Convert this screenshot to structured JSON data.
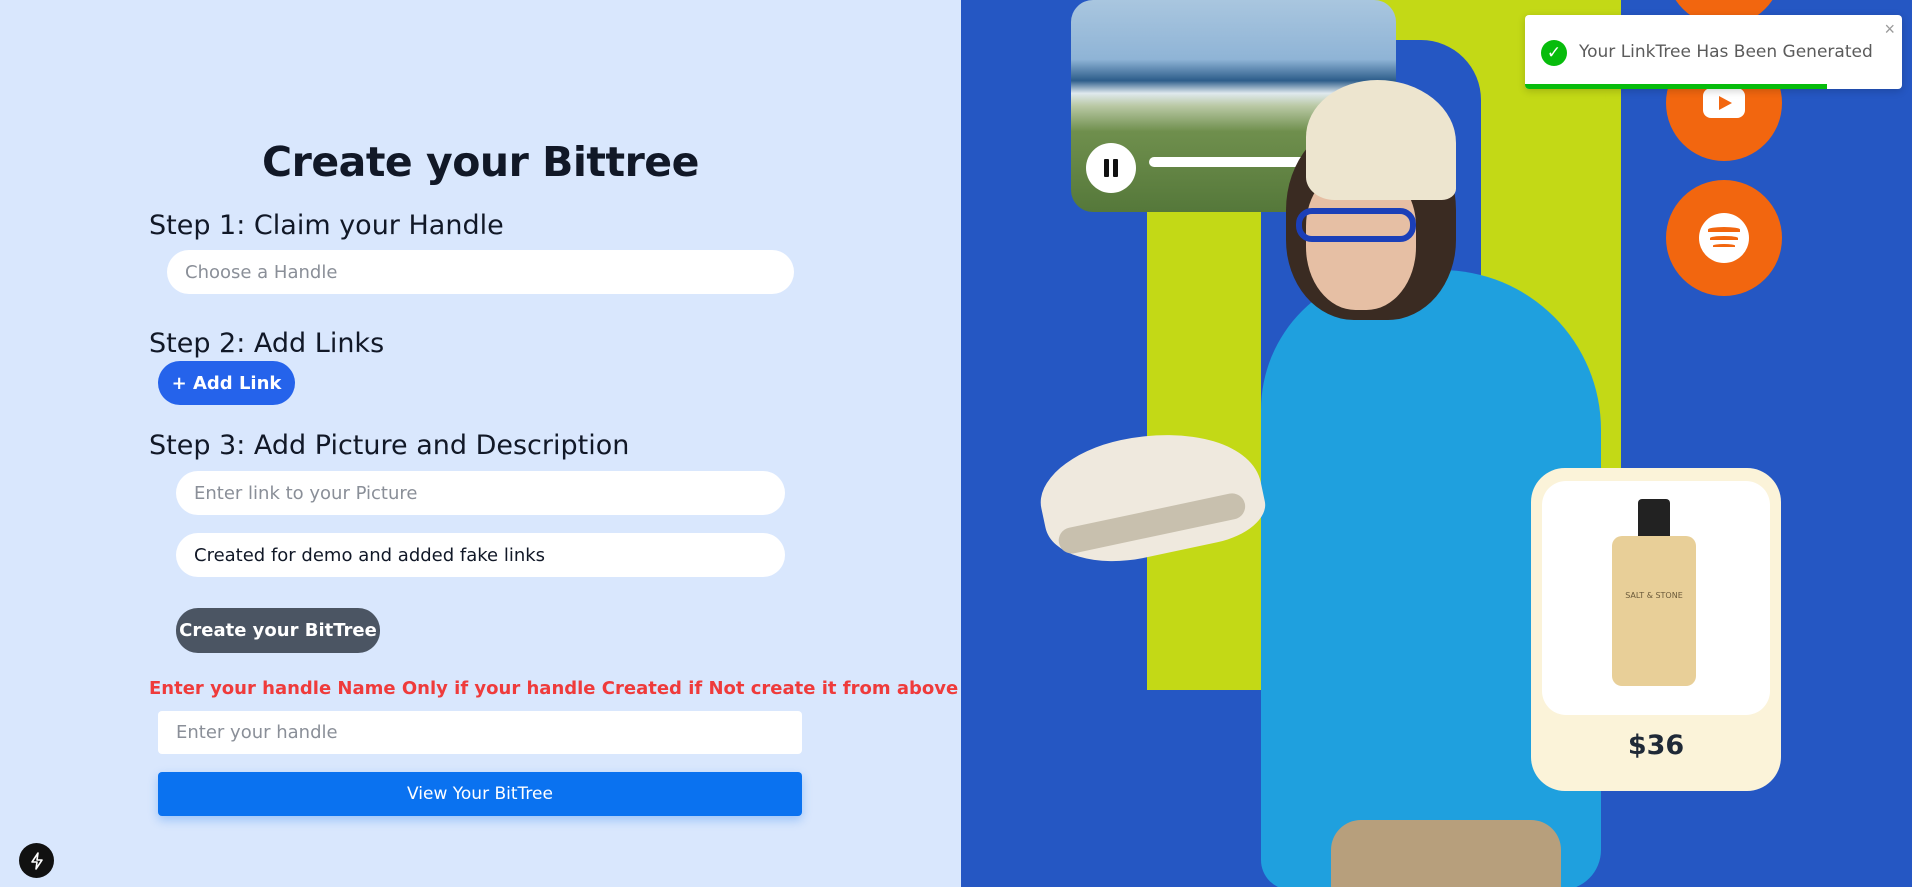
{
  "left_panel": {
    "title": "Create your Bittree",
    "step1": {
      "heading": "Step 1: Claim your Handle",
      "handle_placeholder": "Choose a Handle",
      "handle_value": ""
    },
    "step2": {
      "heading": "Step 2: Add Links",
      "add_link_label": "+ Add Link"
    },
    "step3": {
      "heading": "Step 3: Add Picture and Description",
      "picture_placeholder": "Enter link to your Picture",
      "picture_value": "",
      "description_value": "Created for demo and added fake links"
    },
    "create_label": "Create your BitTree",
    "warning": "Enter your handle Name Only if your handle Created if Not create it from above",
    "view_handle_placeholder": "Enter your handle",
    "view_label": "View Your BitTree"
  },
  "artwork": {
    "product_price": "$36",
    "bottle_label": "SALT & STONE",
    "icons": [
      "pause-icon",
      "youtube-icon",
      "spotify-icon"
    ]
  },
  "toast": {
    "message": "Your LinkTree Has Been Generated",
    "close_glyph": "×",
    "progress": 0.8,
    "accent": "#07bc0c"
  },
  "colors": {
    "primary": "#2563eb",
    "view_button": "#0a72f0",
    "warning": "#ef3b3b",
    "panel_bg": "#d9e7fd",
    "art_blue": "#2557c3",
    "art_green": "#c3d916",
    "art_orange": "#f2660f"
  }
}
